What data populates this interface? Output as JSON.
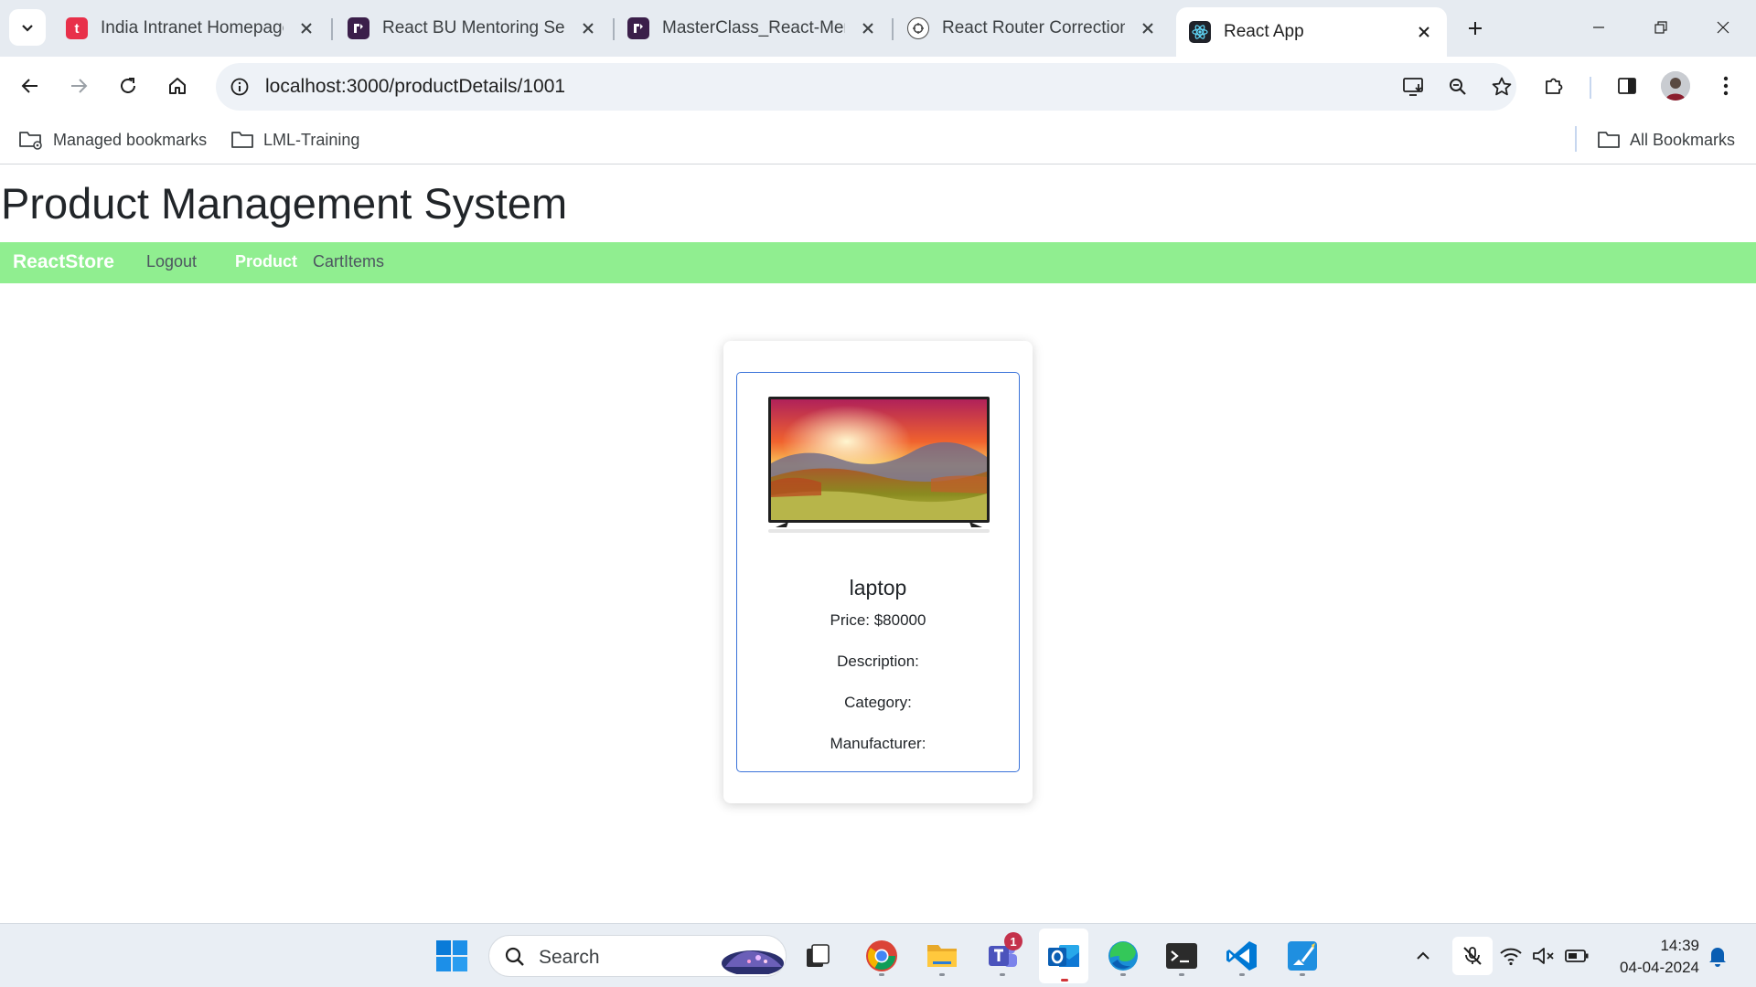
{
  "browser": {
    "tabs": [
      {
        "title": "India Intranet Homepage",
        "icon": "intranet-favicon"
      },
      {
        "title": "React BU Mentoring Sess",
        "icon": "teams-favicon"
      },
      {
        "title": "MasterClass_React-Ment",
        "icon": "teams-favicon"
      },
      {
        "title": "React Router Correction",
        "icon": "chatgpt-favicon"
      },
      {
        "title": "React App",
        "icon": "react-favicon"
      }
    ],
    "url": "localhost:3000/productDetails/1001",
    "bookmarks": [
      {
        "label": "Managed bookmarks",
        "icon": "managed-folder-icon"
      },
      {
        "label": "LML-Training",
        "icon": "folder-icon"
      }
    ],
    "all_bookmarks": "All Bookmarks"
  },
  "app": {
    "title": "Product Management System",
    "brand": "ReactStore",
    "nav": [
      {
        "label": "Logout"
      },
      {
        "label": "Product"
      },
      {
        "label": "CartItems"
      }
    ],
    "active_nav": "Product",
    "nav_color": "#90ee90",
    "product": {
      "name": "laptop",
      "price": "Price: $80000",
      "description": "Description:",
      "category": "Category:",
      "manufacturer": "Manufacturer:",
      "image": "tv-landscape-image"
    }
  },
  "taskbar": {
    "search_placeholder": "Search",
    "teams_badge": "1",
    "time": "14:39",
    "date": "04-04-2024"
  }
}
